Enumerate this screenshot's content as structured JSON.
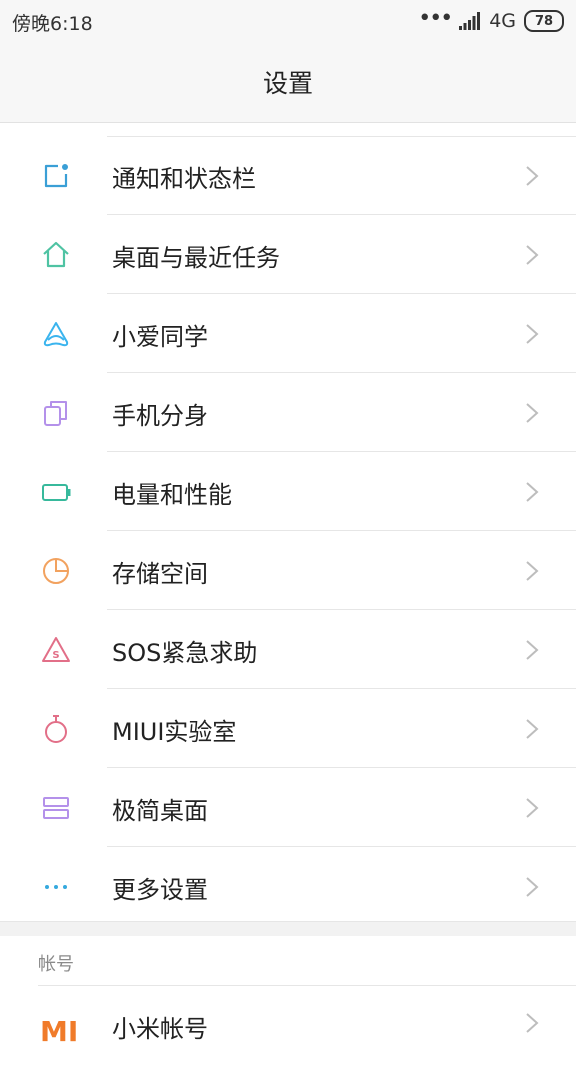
{
  "status_bar": {
    "time": "傍晚6:18",
    "network_type": "4G",
    "battery_level": "78"
  },
  "title": "设置",
  "settings": [
    {
      "label": "通知和状态栏",
      "icon": "notification-icon",
      "icon_color": "#3a9fd6"
    },
    {
      "label": "桌面与最近任务",
      "icon": "home-icon",
      "icon_color": "#4fc3a3"
    },
    {
      "label": "小爱同学",
      "icon": "xiaoai-icon",
      "icon_color": "#3ab4ee"
    },
    {
      "label": "手机分身",
      "icon": "second-space-icon",
      "icon_color": "#b491ea"
    },
    {
      "label": "电量和性能",
      "icon": "battery-icon",
      "icon_color": "#37b99c"
    },
    {
      "label": "存储空间",
      "icon": "storage-icon",
      "icon_color": "#f2a25f"
    },
    {
      "label": "SOS紧急求助",
      "icon": "sos-icon",
      "icon_color": "#e26f88"
    },
    {
      "label": "MIUI实验室",
      "icon": "lab-flask-icon",
      "icon_color": "#e26f88"
    },
    {
      "label": "极简桌面",
      "icon": "minimal-desktop-icon",
      "icon_color": "#b491ea"
    },
    {
      "label": "更多设置",
      "icon": "more-icon",
      "icon_color": "#35a9de"
    }
  ],
  "account_section": {
    "header": "帐号",
    "item": {
      "label": "小米帐号",
      "logo": "MI",
      "icon": "mi-logo-icon",
      "icon_color": "#f07b2a"
    }
  }
}
